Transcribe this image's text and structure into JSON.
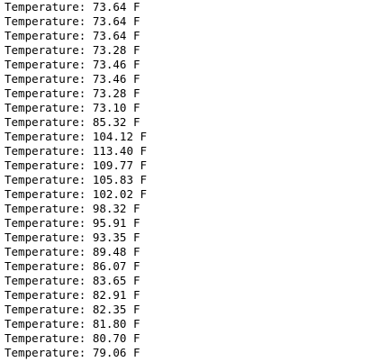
{
  "terminal": {
    "lines": [
      "Temperature: 73.64 F",
      "Temperature: 73.64 F",
      "Temperature: 73.64 F",
      "Temperature: 73.28 F",
      "Temperature: 73.46 F",
      "Temperature: 73.46 F",
      "Temperature: 73.28 F",
      "Temperature: 73.10 F",
      "Temperature: 85.32 F",
      "Temperature: 104.12 F",
      "Temperature: 113.40 F",
      "Temperature: 109.77 F",
      "Temperature: 105.83 F",
      "Temperature: 102.02 F",
      "Temperature: 98.32 F",
      "Temperature: 95.91 F",
      "Temperature: 93.35 F",
      "Temperature: 89.48 F",
      "Temperature: 86.07 F",
      "Temperature: 83.65 F",
      "Temperature: 82.91 F",
      "Temperature: 82.35 F",
      "Temperature: 81.80 F",
      "Temperature: 80.70 F",
      "Temperature: 79.06 F"
    ]
  }
}
